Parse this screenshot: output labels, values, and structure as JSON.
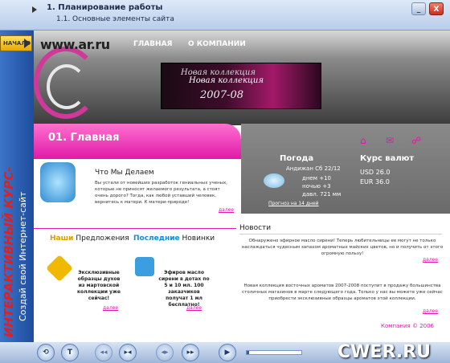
{
  "window": {
    "title": "1. Планирование работы",
    "subtitle": "1.1. Основные элементы сайта",
    "minimize": "_",
    "close": "X"
  },
  "sidebar": {
    "start_label": "НАЧАЛО",
    "course_title": "ИНТЕРАКТИВНЫЙ КУРС-",
    "course_sub": "Создай свой Интернет-сайт"
  },
  "site": {
    "logo": "www.ar.ru",
    "nav": [
      "ГЛАВНАЯ",
      "О КОМПАНИИ"
    ],
    "banner": {
      "line1": "Новая коллекция",
      "line2": "Новая коллекция",
      "line3": "2007-08"
    },
    "page_title": "01. Главная",
    "weather": {
      "title": "Погода",
      "date": "Андижан Сб 22/12",
      "day": "днем +10",
      "night": "ночью +3",
      "pressure": "давл. 721 мм",
      "forecast_link": "Прогноз на 14 дней"
    },
    "currency": {
      "title": "Курс валют",
      "usd": "USD 26.0",
      "eur": "EUR 36.0"
    },
    "about": {
      "heading": "Что Мы Делаем",
      "text": "Вы устали от новейших разработок гениальных ученых, которые не приносят желаемого результата, а стоят очень дорого? Тогда, как любой уставший человек, вернитесь к матери. К матери-природе!",
      "more": "далее"
    },
    "offers": {
      "left_accent": "Наши",
      "left_rest": " Предложения",
      "right_accent": "Последние",
      "right_rest": " Новинки",
      "item1": "Эксклюзивные образцы духов из мартовской коллекции уже сейчас!",
      "item2": "Эфиров масло сирени в дотах по 5 и 10 мл. 100 заказчиков получат 1 мл бесплатно!",
      "more1": "далее",
      "more2": "далее"
    },
    "news": {
      "title": "Новости",
      "item1": "Обнаружено эфирное масло сирени! Теперь любительницы ее могут не только наслаждаться чудесным запахом ароматных майских цветов, но и получить от этого огромную пользу!",
      "more1": "далее",
      "item2": "Новая коллекция восточных ароматов 2007-2008 поступит в продажу большинства столичных магазинов в марте следующего года. Только у нас вы можете уже сейчас приобрести эксклюзивные образцы ароматов этой коллекции.",
      "more2": "далее"
    },
    "copyright": "Компания © 2006"
  },
  "player": {
    "buttons": [
      "⟲",
      "T",
      "◂◂",
      "▸◂",
      "◂▸",
      "▸▸",
      "▶",
      "■"
    ],
    "progress": 0.05
  },
  "watermark": "CWER.RU",
  "colors": {
    "accent": "#e01aa8",
    "brand": "#2b5fb0"
  }
}
